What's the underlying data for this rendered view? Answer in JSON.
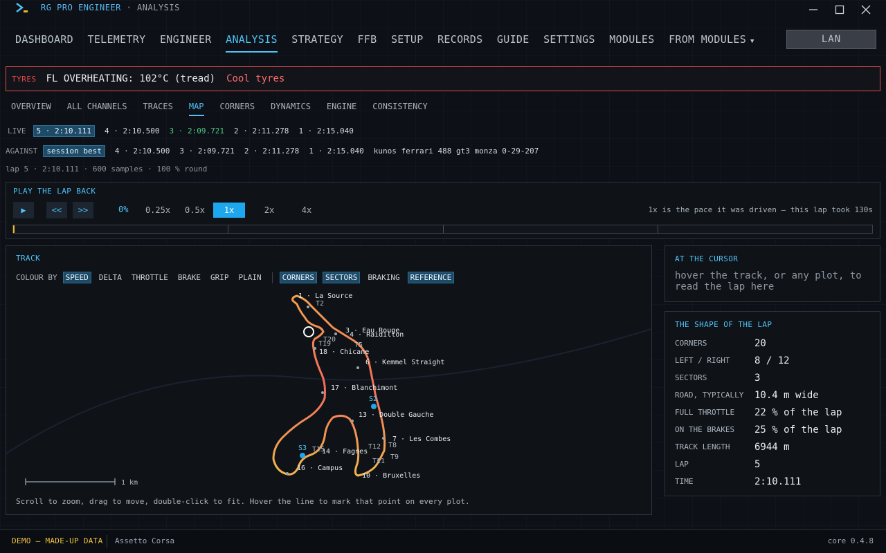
{
  "app": {
    "title": "RG PRO ENGINEER",
    "subtitle": "· ANALYSIS"
  },
  "nav": {
    "tabs": [
      "DASHBOARD",
      "TELEMETRY",
      "ENGINEER",
      "ANALYSIS",
      "STRATEGY",
      "FFB",
      "SETUP",
      "RECORDS",
      "GUIDE",
      "SETTINGS",
      "MODULES",
      "FROM MODULES"
    ],
    "active": "ANALYSIS",
    "lan": "LAN"
  },
  "alert": {
    "tag": "TYRES",
    "message": "FL OVERHEATING: 102°C (tread)",
    "action": "Cool tyres"
  },
  "subnav": {
    "tabs": [
      "OVERVIEW",
      "ALL CHANNELS",
      "TRACES",
      "MAP",
      "CORNERS",
      "DYNAMICS",
      "ENGINE",
      "CONSISTENCY"
    ],
    "active": "MAP"
  },
  "live": {
    "label": "LIVE",
    "laps": [
      "5 · 2:10.111",
      "4 · 2:10.500",
      "3 · 2:09.721",
      "2 · 2:11.278",
      "1 · 2:15.040"
    ]
  },
  "against": {
    "label": "AGAINST",
    "items": [
      "session best",
      "4 · 2:10.500",
      "3 · 2:09.721",
      "2 · 2:11.278",
      "1 · 2:15.040",
      "kunos ferrari 488 gt3 monza 0-29-207"
    ]
  },
  "lapinfo": "lap 5 · 2:10.111 · 600 samples · 100 % round",
  "playback": {
    "title": "PLAY THE LAP BACK",
    "play": "▶",
    "back": "<<",
    "fwd": ">>",
    "progress": "0%",
    "progress_value": 0,
    "speeds": [
      "0.25x",
      "0.5x",
      "1x",
      "2x",
      "4x"
    ],
    "active_speed": "1x",
    "note": "1x is the pace it was driven — this lap took 130s"
  },
  "track": {
    "title": "TRACK",
    "colour_by_label": "COLOUR BY",
    "colour_options": [
      "SPEED",
      "DELTA",
      "THROTTLE",
      "BRAKE",
      "GRIP",
      "PLAIN"
    ],
    "colour_active": "SPEED",
    "overlays": [
      "CORNERS",
      "SECTORS",
      "BRAKING",
      "REFERENCE"
    ],
    "overlays_on": [
      "CORNERS",
      "SECTORS",
      "REFERENCE"
    ],
    "scale": "1 km",
    "hint": "Scroll to zoom, drag to move, double-click to fit. Hover the line to mark that point on every plot.",
    "labels": {
      "c1": "1 · La Source",
      "t2": "T2",
      "c3": "3 · Eau Rouge",
      "c4": "4 · Raidillon",
      "t20": "T20",
      "t19": "T19",
      "t5": "T5",
      "c18": "18 · Chicane",
      "c6": "6 · Kemmel Straight",
      "c17": "17 · Blanchimont",
      "s2": "S2",
      "c13": "13 · Double Gauche",
      "c7": "7 · Les Combes",
      "t12": "T12",
      "t8": "T8",
      "t9": "T9",
      "t11": "T11",
      "s3": "S3",
      "t15": "T15",
      "c14": "14 · Fagnes",
      "c16": "16 · Campus",
      "c10": "10 · Bruxelles"
    }
  },
  "cursor": {
    "title": "AT THE CURSOR",
    "text": "hover the track, or any plot, to read the lap here"
  },
  "shape": {
    "title": "THE SHAPE OF THE LAP",
    "rows": [
      {
        "k": "CORNERS",
        "v": "20"
      },
      {
        "k": "LEFT / RIGHT",
        "v": "8 / 12"
      },
      {
        "k": "SECTORS",
        "v": "3"
      },
      {
        "k": "ROAD, TYPICALLY",
        "v": "10.4 m wide"
      },
      {
        "k": "FULL THROTTLE",
        "v": "22 % of the lap"
      },
      {
        "k": "ON THE BRAKES",
        "v": "25 % of the lap"
      },
      {
        "k": "TRACK LENGTH",
        "v": "6944 m"
      },
      {
        "k": "LAP",
        "v": "5"
      },
      {
        "k": "TIME",
        "v": "2:10.111"
      }
    ]
  },
  "footer": {
    "demo": "DEMO — MADE-UP DATA",
    "sim": "Assetto Corsa",
    "version": "core 0.4.8"
  },
  "colors": {
    "accent": "#4fc3f7",
    "alert": "#e24a4a",
    "best": "#4ec98a",
    "demo": "#f0c040"
  }
}
